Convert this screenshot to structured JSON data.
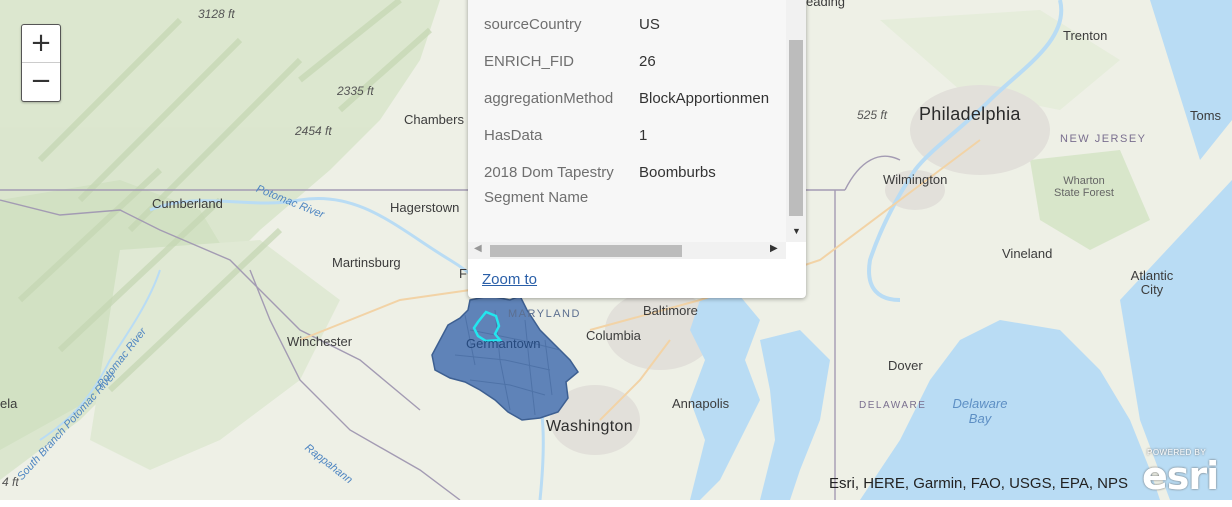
{
  "map": {
    "place_labels": [
      {
        "id": "trenton",
        "text": "Trenton"
      },
      {
        "id": "philadelphia",
        "text": "Philadelphia"
      },
      {
        "id": "toms",
        "text": "Toms"
      },
      {
        "id": "reading",
        "text": "eading"
      },
      {
        "id": "wilmington",
        "text": "Wilmington"
      },
      {
        "id": "vineland",
        "text": "Vineland"
      },
      {
        "id": "atlantic-city",
        "text": "Atlantic City"
      },
      {
        "id": "dover",
        "text": "Dover"
      },
      {
        "id": "baltimore",
        "text": "Baltimore"
      },
      {
        "id": "columbia",
        "text": "Columbia"
      },
      {
        "id": "annapolis",
        "text": "Annapolis"
      },
      {
        "id": "washington",
        "text": "Washington"
      },
      {
        "id": "germantown",
        "text": "Germantown"
      },
      {
        "id": "frederick",
        "text": "F"
      },
      {
        "id": "chambersburg",
        "text": "Chambers"
      },
      {
        "id": "hagerstown",
        "text": "Hagerstown"
      },
      {
        "id": "cumberland",
        "text": "Cumberland"
      },
      {
        "id": "martinsburg",
        "text": "Martinsburg"
      },
      {
        "id": "winchester",
        "text": "Winchester"
      },
      {
        "id": "ela",
        "text": "ela"
      }
    ],
    "elevation_labels": [
      {
        "id": "e3128",
        "text": "3128 ft"
      },
      {
        "id": "e2335",
        "text": "2335 ft"
      },
      {
        "id": "e2454",
        "text": "2454 ft"
      },
      {
        "id": "e525",
        "text": "525 ft"
      },
      {
        "id": "e4",
        "text": "4 ft"
      }
    ],
    "river_labels": [
      {
        "id": "potomac-river",
        "text": "Potomac River"
      },
      {
        "id": "potomac-river-2",
        "text": "Potomac River"
      },
      {
        "id": "south-branch-potomac",
        "text": "South Branch Potomac River"
      },
      {
        "id": "rappahannock",
        "text": "Rappahann"
      }
    ],
    "state_labels": [
      {
        "id": "new-jersey",
        "text": "NEW JERSEY"
      },
      {
        "id": "maryland",
        "text": "MARYLAND"
      },
      {
        "id": "delaware",
        "text": "DELAWARE"
      }
    ],
    "forest_label": "Wharton State Forest",
    "bay_label": "Delaware Bay",
    "zoom": {
      "in_label": "+",
      "out_label": "−"
    }
  },
  "popup": {
    "fields": [
      {
        "key": "sourceCountry",
        "value": "US"
      },
      {
        "key": "ENRICH_FID",
        "value": "26"
      },
      {
        "key": "aggregationMethod",
        "value": "BlockApportionmen"
      },
      {
        "key": "HasData",
        "value": "1"
      },
      {
        "key": "2018 Dom Tapestry Segment Name",
        "value": "Boomburbs"
      }
    ],
    "zoom_to_label": "Zoom to"
  },
  "attribution": "Esri, HERE, Garmin, FAO, USGS, EPA, NPS",
  "esri_logo": {
    "powered_by": "POWERED BY",
    "word": "esri"
  },
  "colors": {
    "selection_fill": "#5f83b8",
    "highlight": "#22e6ee",
    "water": "#b9dcf4",
    "land": "#eef0e6",
    "link": "#2a5fa8"
  }
}
